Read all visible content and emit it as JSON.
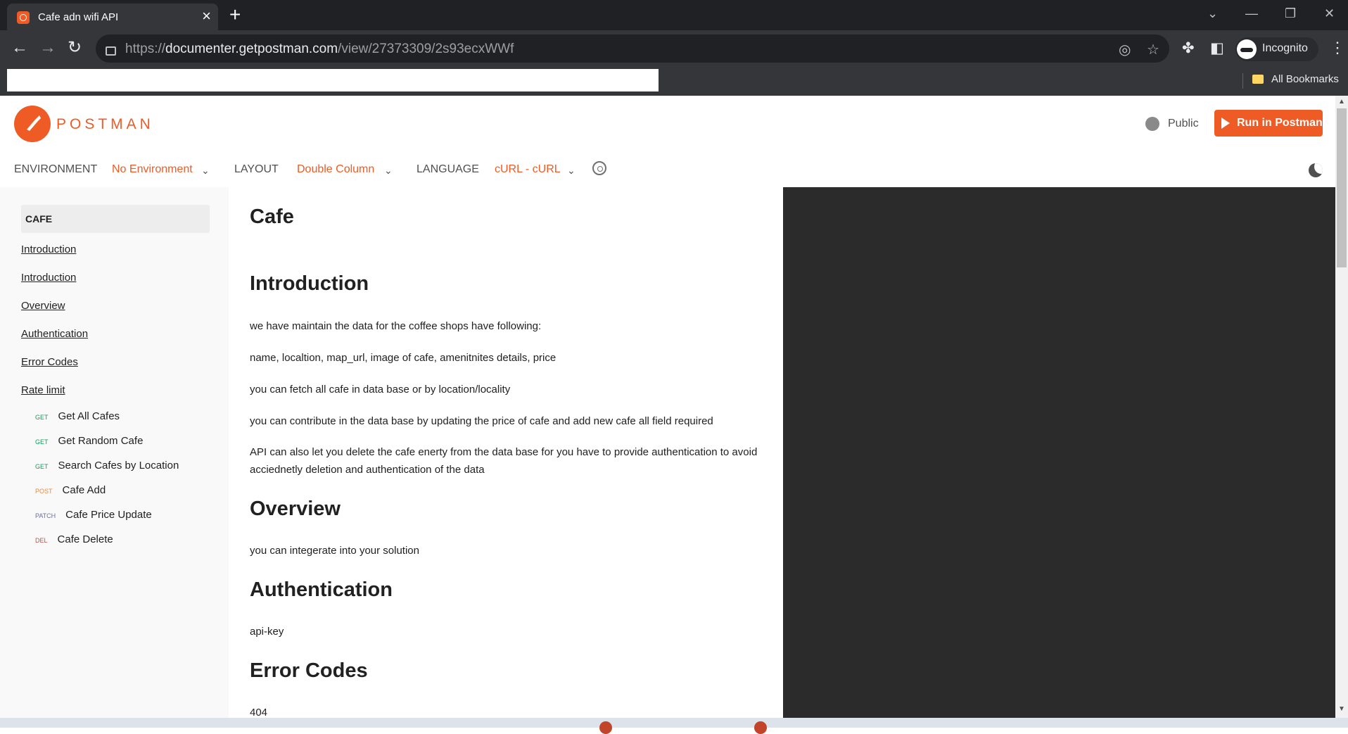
{
  "browser": {
    "tab_title": "Cafe adn wifi API",
    "url_prefix": "https://",
    "url_host": "documenter.getpostman.com",
    "url_path": "/view/27373309/2s93ecxWWf",
    "profile_label": "Incognito",
    "bookmarks_label": "All Bookmarks"
  },
  "header": {
    "logo_text": "POSTMAN",
    "visibility_label": "Public",
    "run_button_label": "Run in Postman"
  },
  "settings": {
    "environment_label": "ENVIRONMENT",
    "environment_value": "No Environment",
    "layout_label": "LAYOUT",
    "layout_value": "Double Column",
    "language_label": "LANGUAGE",
    "language_value": "cURL - cURL"
  },
  "sidebar": {
    "heading": "CAFE",
    "links": [
      "Introduction",
      "Introduction",
      "Overview",
      "Authentication",
      "Error Codes",
      "Rate limit"
    ],
    "requests": [
      {
        "method": "GET",
        "name": "Get All Cafes"
      },
      {
        "method": "GET",
        "name": "Get Random Cafe"
      },
      {
        "method": "GET",
        "name": "Search Cafes by Location"
      },
      {
        "method": "POST",
        "name": "Cafe Add"
      },
      {
        "method": "PATCH",
        "name": "Cafe Price Update"
      },
      {
        "method": "DEL",
        "name": "Cafe Delete"
      }
    ]
  },
  "main": {
    "title": "Cafe",
    "intro_heading": "Introduction",
    "intro_p1": "we have maintain the data for the coffee shops have following:",
    "intro_p2": "name, localtion, map_url, image of cafe, amenitnites details, price",
    "intro_p3": "you can fetch all cafe in data base or by location/locality",
    "intro_p4": "you can contribute in the data base by updating the price of cafe and add new cafe all field required",
    "intro_p5": "API can also let you delete the cafe enerty from the data base for you have to provide authentication to avoid acciednetly deletion and authentication of the data",
    "overview_heading": "Overview",
    "overview_p": "you can integerate into your solution",
    "auth_heading": "Authentication",
    "auth_p": "api-key",
    "errors_heading": "Error Codes",
    "errors_p": "404"
  },
  "colors": {
    "accent": "#ef5b25",
    "code_panel": "#2b2b2b",
    "sidebar_bg": "#f9f9f9"
  }
}
